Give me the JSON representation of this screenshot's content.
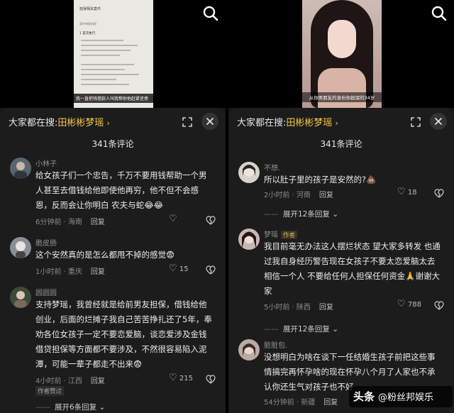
{
  "left_panel": {
    "preview": {
      "doc_heading": "担保相关案件",
      "doc_subheading": "案件审理流程",
      "doc_section": "1 首次执行",
      "caption": "我一直把钱借款人叫我帮助他赶紧还债"
    },
    "search": {
      "prefix": "大家都在搜:",
      "term": "田彬彬梦瑶",
      "arrow": "›"
    },
    "comment_count": "341条评论",
    "comments": [
      {
        "username": "小林子",
        "text": "给女孩子们一个忠告，千万不要用钱帮助一个男人甚至去借钱给他即使他再穷，他不但不会感恩，反而会让你明白  农夫与蛇😂😂",
        "time": "6分钟前 · 海南",
        "reply_label": "回复",
        "likes": ""
      },
      {
        "username": "脆皮肠",
        "text": "这个安然真的是怎么都甩不掉的感觉😨",
        "time": "1小时前 · 重庆",
        "reply_label": "回复",
        "likes": "15"
      },
      {
        "username": "圆圆圆",
        "text": "支持梦瑶，我曾经就是给前男友担保，借钱给他创业，后面的烂摊子我自己苦苦挣扎还了5年，奉劝各位女孩子一定不要恋爱脑，谈恋爱涉及金钱借贷担保等方面都不要涉及，不然很容易陷入泥潭，可能一辈子都走不出来😨",
        "time": "4小时前 · 江西",
        "reply_label": "回复",
        "likes": "215",
        "badge": "作者赞过"
      }
    ],
    "expand_replies": "展开6条回复"
  },
  "right_panel": {
    "preview": {
      "caption": "从你男朋友的身份你担保的34岁"
    },
    "search": {
      "prefix": "大家都在搜:",
      "term": "田彬彬梦瑶",
      "arrow": "›"
    },
    "comment_count": "341条评论",
    "comments": [
      {
        "username": "不想.",
        "text": "所以肚子里的孩子是安然的?💩",
        "time": "2小时前 · 河南",
        "reply_label": "回复",
        "likes": "18",
        "expand_replies": "展开12条回复"
      },
      {
        "username": "梦瑶",
        "author_tag": "作者",
        "text": "我目前毫无办法这人摆烂状态 望大家多转发 也通过我自身经历警告现在女孩子不要太恋爱脑太去相信一个人 不要给任何人担保任何资金🙏谢谢大家",
        "time": "5小时前 · 陕西",
        "reply_label": "回复",
        "likes": "788",
        "expand_replies": "展开12条回复"
      },
      {
        "username": "脏脏包.",
        "text": "没想明白为啥在谈下一任结婚生孩子前把这些事情搞完再怀孕啥的现在怀孕八个月了人家也不承认你还生气对孩子也不好",
        "time": "54分钟前 · 新疆",
        "reply_label": "回复",
        "likes": ""
      }
    ]
  },
  "watermark": {
    "brand": "头条",
    "handle": "@粉丝邦娱乐"
  },
  "colors": {
    "accent": "#f5c84c",
    "background": "#1c1c1c",
    "text": "#ececec",
    "muted": "#8a8a8a"
  }
}
